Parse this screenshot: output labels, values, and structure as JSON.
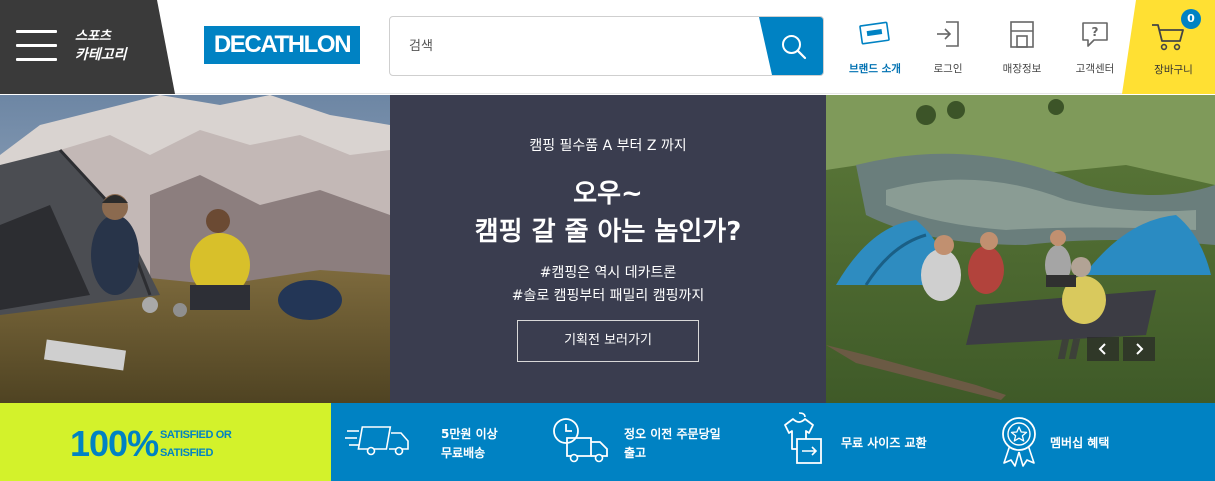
{
  "header": {
    "category": {
      "line1": "스포츠",
      "line2": "카테고리"
    },
    "logo": "DECATHLON",
    "search": {
      "placeholder": "검색",
      "value": ""
    },
    "nav": [
      {
        "label": "브랜드 소개",
        "icon": "brand-card-icon"
      },
      {
        "label": "로그인",
        "icon": "login-icon"
      },
      {
        "label": "매장정보",
        "icon": "store-info-icon"
      },
      {
        "label": "고객센터",
        "icon": "help-chat-icon"
      }
    ],
    "cart": {
      "label": "장바구니",
      "count": "0",
      "icon": "cart-icon"
    }
  },
  "hero": {
    "kicker": "캠핑 필수품 A 부터 Z 까지",
    "headline_line1": "오우~",
    "headline_line2": "캠핑 갈 줄 아는 놈인가?",
    "tag1": "#캠핑은 역시 데카트론",
    "tag2": "#솔로 캠핑부터 패밀리 캠핑까지",
    "cta": "기획전 보러가기",
    "left_image": "campers-by-tent-mountains",
    "right_image": "family-camping-by-lake"
  },
  "features": {
    "satisfied": {
      "big": "100%",
      "line1": "SATISFIED OR",
      "line2": "SATISFIED"
    },
    "items": [
      {
        "line1": "5만원 이상",
        "line2": "무료배송",
        "icon": "delivery-truck-icon"
      },
      {
        "line1": "정오 이전 주문당일",
        "line2": "출고",
        "icon": "clock-truck-icon"
      },
      {
        "line1": "무료 사이즈 교환",
        "icon": "size-exchange-icon"
      },
      {
        "line1": "멤버십 혜택",
        "icon": "membership-medal-icon"
      }
    ]
  },
  "colors": {
    "brand_blue": "#0082c3",
    "cart_yellow": "#ffe033",
    "category_dark": "#3a3a3a",
    "hero_panel": "#3a3d4f",
    "satisfied_green": "#d3f22b"
  }
}
